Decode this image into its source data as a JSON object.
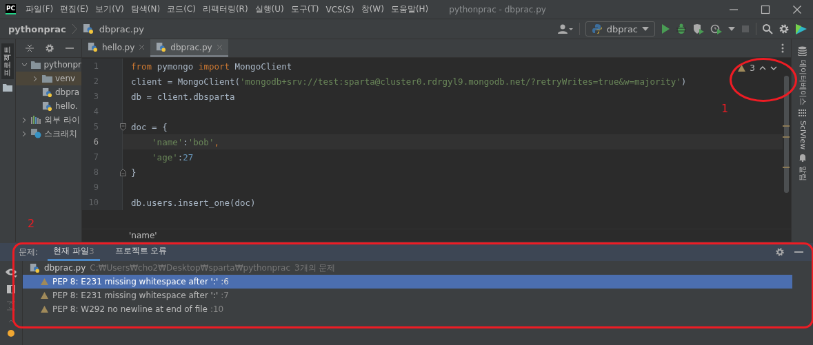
{
  "window": {
    "logo": "PC",
    "menu": [
      "파일(F)",
      "편집(E)",
      "보기(V)",
      "탐색(N)",
      "코드(C)",
      "리팩터링(R)",
      "실행(U)",
      "도구(T)",
      "VCS(S)",
      "창(W)",
      "도움말(H)"
    ],
    "title": "pythonprac - dbprac.py"
  },
  "navbar": {
    "breadcrumb": [
      "pythonprac",
      "dbprac.py"
    ],
    "run_config": "dbprac"
  },
  "left_strip": {
    "label": "프로젝트"
  },
  "project_tree": [
    {
      "label": "pythonpr",
      "kind": "folder",
      "expanded": true,
      "selected": false,
      "children": [
        {
          "label": "venv",
          "kind": "folder",
          "expanded": false,
          "selected": true
        },
        {
          "label": "dbpra",
          "kind": "python",
          "selected": false
        },
        {
          "label": "hello.",
          "kind": "python",
          "selected": false
        }
      ]
    },
    {
      "label": "외부 라이",
      "kind": "library",
      "expanded": false,
      "selected": false
    },
    {
      "label": "스크래치",
      "kind": "scratch",
      "expanded": false,
      "selected": false
    }
  ],
  "tabs": [
    {
      "label": "hello.py",
      "selected": false
    },
    {
      "label": "dbprac.py",
      "selected": true
    }
  ],
  "editor": {
    "warning_count": "3",
    "lines": [
      {
        "number": "1",
        "current": false,
        "tokens": [
          {
            "text": "from ",
            "kind": "keyword"
          },
          {
            "text": "pymongo ",
            "kind": "plain"
          },
          {
            "text": "import ",
            "kind": "keyword"
          },
          {
            "text": "MongoClient",
            "kind": "plain"
          }
        ]
      },
      {
        "number": "2",
        "current": false,
        "tokens": [
          {
            "text": "client = MongoClient(",
            "kind": "plain"
          },
          {
            "text": "'mongodb+srv://test:sparta@cluster0.rdrgyl9.mongodb.net/?retryWrites=true&w=majority'",
            "kind": "string"
          },
          {
            "text": ")",
            "kind": "plain"
          }
        ]
      },
      {
        "number": "3",
        "current": false,
        "tokens": [
          {
            "text": "db = client.dbsparta",
            "kind": "plain"
          }
        ]
      },
      {
        "number": "4",
        "current": false
      },
      {
        "number": "5",
        "current": false,
        "fold_start": true,
        "tokens": [
          {
            "text": "doc = {",
            "kind": "plain"
          }
        ]
      },
      {
        "number": "6",
        "current": true,
        "indented": true,
        "tokens": [
          {
            "text": "'name'",
            "kind": "string"
          },
          {
            "text": ":",
            "kind": "plain"
          },
          {
            "text": "'bob'",
            "kind": "string"
          },
          {
            "text": ",",
            "kind": "keyword"
          }
        ]
      },
      {
        "number": "7",
        "current": false,
        "indented": true,
        "tokens": [
          {
            "text": "'age'",
            "kind": "string"
          },
          {
            "text": ":",
            "kind": "plain"
          },
          {
            "text": "27",
            "kind": "number"
          }
        ]
      },
      {
        "number": "8",
        "current": false,
        "fold_end": true,
        "tokens": [
          {
            "text": "}",
            "kind": "plain"
          }
        ]
      },
      {
        "number": "9",
        "current": false
      },
      {
        "number": "10",
        "current": false,
        "tokens": [
          {
            "text": "db.users.insert_one(doc)",
            "kind": "plain"
          }
        ]
      }
    ],
    "breadcrumb": "'name'"
  },
  "right_strip": [
    "데이터베이스",
    "SciView",
    "알림"
  ],
  "problems": {
    "label": "문제:",
    "tabs": [
      {
        "label": "현재 파일",
        "count": "3",
        "selected": true
      },
      {
        "label": "프로젝트 오류",
        "selected": false
      }
    ],
    "file": {
      "name": "dbprac.py",
      "path": "C:₩Users₩cho2₩Desktop₩sparta₩pythonprac",
      "summary": "3개의 문제"
    },
    "issues": [
      {
        "text": "PEP 8: E231 missing whitespace after ':'",
        "line": ":6",
        "selected": true
      },
      {
        "text": "PEP 8: E231 missing whitespace after ':'",
        "line": ":7",
        "selected": false
      },
      {
        "text": "PEP 8: W292 no newline at end of file",
        "line": ":10",
        "selected": false
      }
    ]
  },
  "annotations": [
    {
      "kind": "ellipse"
    },
    {
      "kind": "number",
      "text": "1"
    },
    {
      "kind": "number",
      "text": "2"
    },
    {
      "kind": "frame"
    }
  ]
}
